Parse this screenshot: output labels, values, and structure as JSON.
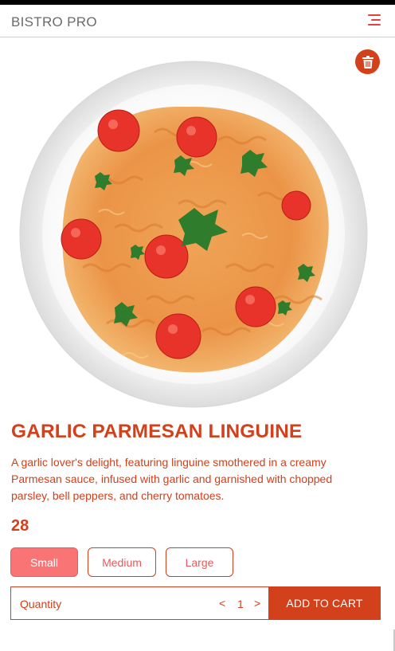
{
  "header": {
    "brand": "BISTRO PRO",
    "menu_icon": "hamburger-menu-icon"
  },
  "actions": {
    "delete_icon": "trash-icon"
  },
  "product": {
    "image_alt": "pasta-dish-image",
    "title": "GARLIC PARMESAN LINGUINE",
    "description": "A garlic lover's delight, featuring linguine smothered in a creamy Parmesan sauce, infused with garlic and garnished with chopped parsley, bell peppers, and cherry tomatoes.",
    "price": "28"
  },
  "sizes": {
    "options": [
      "Small",
      "Medium",
      "Large"
    ],
    "selected": "Small"
  },
  "quantity": {
    "label": "Quantity",
    "decrement": "<",
    "value": "1",
    "increment": ">"
  },
  "cart": {
    "add_label": "ADD TO CART"
  },
  "colors": {
    "accent": "#d2401c",
    "selected_size_bg": "#f97475",
    "menu_icon": "#e2413f",
    "brand_text": "#6b6b6b"
  }
}
